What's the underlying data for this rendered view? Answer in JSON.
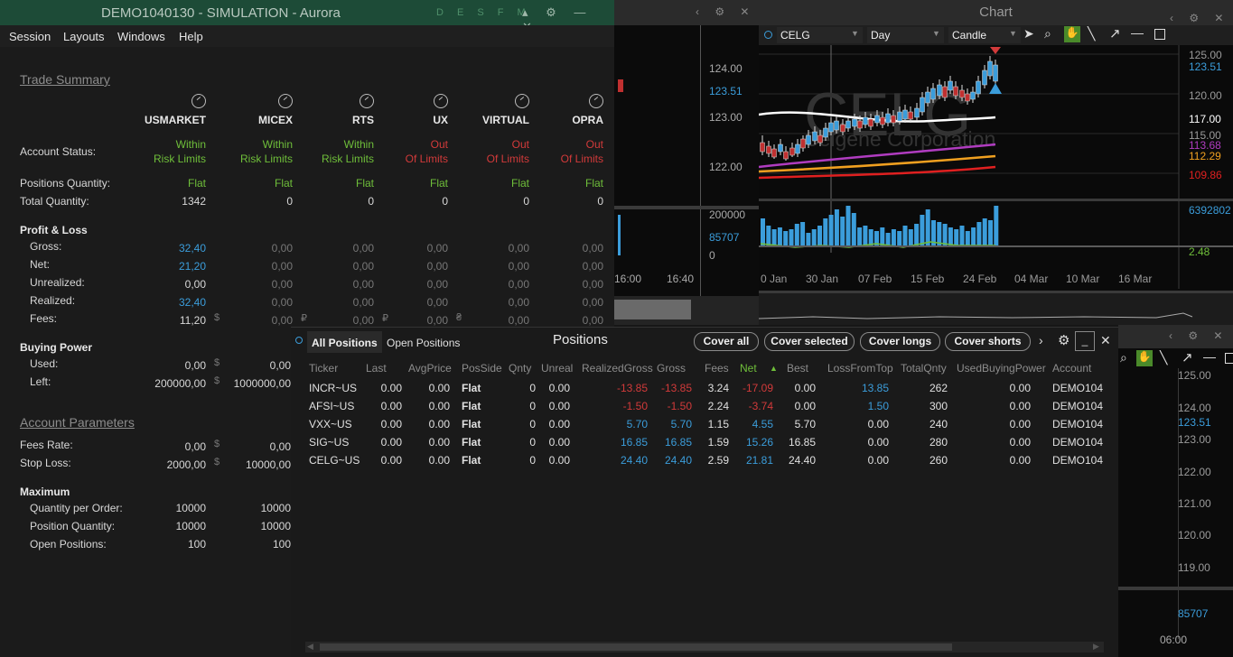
{
  "main_window": {
    "title": "DEMO1040130 - SIMULATION - Aurora",
    "title_icons": "D E S F M",
    "menu": [
      "Session",
      "Layouts",
      "Windows",
      "Help"
    ]
  },
  "trade_summary": {
    "title": "Trade Summary",
    "columns": [
      "USMARKET",
      "MICEX",
      "RTS",
      "UX",
      "VIRTUAL",
      "OPRA"
    ],
    "account_status_label": "Account Status:",
    "account_status": [
      {
        "l1": "Within",
        "l2": "Risk Limits",
        "color": "#6fbf3a"
      },
      {
        "l1": "Within",
        "l2": "Risk Limits",
        "color": "#6fbf3a"
      },
      {
        "l1": "Within",
        "l2": "Risk Limits",
        "color": "#6fbf3a"
      },
      {
        "l1": "Out",
        "l2": "Of Limits",
        "color": "#d23a3a"
      },
      {
        "l1": "Out",
        "l2": "Of Limits",
        "color": "#d23a3a"
      },
      {
        "l1": "Out",
        "l2": "Of Limits",
        "color": "#d23a3a"
      }
    ],
    "positions_quantity_label": "Positions Quantity:",
    "positions_quantity": [
      "Flat",
      "Flat",
      "Flat",
      "Flat",
      "Flat",
      "Flat"
    ],
    "total_quantity_label": "Total Quantity:",
    "total_quantity": [
      "1342",
      "0",
      "0",
      "0",
      "0",
      "0"
    ],
    "pnl_label": "Profit & Loss",
    "gross_label": "Gross:",
    "gross": [
      "32,40",
      "0,00",
      "0,00",
      "0,00",
      "0,00",
      "0,00"
    ],
    "net_label": "Net:",
    "net": [
      "21,20",
      "0,00",
      "0,00",
      "0,00",
      "0,00",
      "0,00"
    ],
    "unrealized_label": "Unrealized:",
    "unrealized": [
      "0,00",
      "0,00",
      "0,00",
      "0,00",
      "0,00",
      "0,00"
    ],
    "realized_label": "Realized:",
    "realized": [
      "32,40",
      "0,00",
      "0,00",
      "0,00",
      "0,00",
      "0,00"
    ],
    "fees_label": "Fees:",
    "fees": [
      "11,20",
      "0,00",
      "0,00",
      "0,00",
      "0,00",
      "0,00"
    ],
    "fees_currency": [
      "$",
      "₽",
      "₽",
      "₴",
      ""
    ],
    "buying_power_label": "Buying Power",
    "used_label": "Used:",
    "used": [
      "0,00",
      "0,00"
    ],
    "left_label": "Left:",
    "left": [
      "200000,00",
      "1000000,00"
    ],
    "currency_usd": "$"
  },
  "account_parameters": {
    "title": "Account Parameters",
    "fees_rate_label": "Fees Rate:",
    "fees_rate": [
      "0,00",
      "0,00"
    ],
    "stop_loss_label": "Stop Loss:",
    "stop_loss": [
      "2000,00",
      "10000,00"
    ],
    "maximum_label": "Maximum",
    "qpo_label": "Quantity per Order:",
    "qpo": [
      "10000",
      "10000"
    ],
    "pq_label": "Position Quantity:",
    "pq": [
      "10000",
      "10000"
    ],
    "op_label": "Open Positions:",
    "op": [
      "100",
      "100"
    ]
  },
  "positions": {
    "tab_all": "All Positions",
    "tab_open": "Open Positions",
    "title": "Positions",
    "buttons": [
      "Cover all",
      "Cover selected",
      "Cover longs",
      "Cover shorts"
    ],
    "headers": [
      "Ticker",
      "Last",
      "AvgPrice",
      "PosSide",
      "Qnty",
      "Unreal",
      "RealizedGross",
      "Gross",
      "Fees",
      "Net",
      "Best",
      "LossFromTop",
      "TotalQnty",
      "UsedBuyingPower",
      "Account"
    ],
    "rows": [
      [
        "INCR~US",
        "0.00",
        "0.00",
        "Flat",
        "0",
        "0.00",
        "-13.85",
        "-13.85",
        "3.24",
        "-17.09",
        "0.00",
        "13.85",
        "262",
        "0.00",
        "DEMO104"
      ],
      [
        "AFSI~US",
        "0.00",
        "0.00",
        "Flat",
        "0",
        "0.00",
        "-1.50",
        "-1.50",
        "2.24",
        "-3.74",
        "0.00",
        "1.50",
        "300",
        "0.00",
        "DEMO104"
      ],
      [
        "VXX~US",
        "0.00",
        "0.00",
        "Flat",
        "0",
        "0.00",
        "5.70",
        "5.70",
        "1.15",
        "4.55",
        "5.70",
        "0.00",
        "240",
        "0.00",
        "DEMO104"
      ],
      [
        "SIG~US",
        "0.00",
        "0.00",
        "Flat",
        "0",
        "0.00",
        "16.85",
        "16.85",
        "1.59",
        "15.26",
        "16.85",
        "0.00",
        "280",
        "0.00",
        "DEMO104"
      ],
      [
        "CELG~US",
        "0.00",
        "0.00",
        "Flat",
        "0",
        "0.00",
        "24.40",
        "24.40",
        "2.59",
        "21.81",
        "24.40",
        "0.00",
        "260",
        "0.00",
        "DEMO104"
      ]
    ]
  },
  "chart": {
    "title": "Chart",
    "symbol": "CELG",
    "interval": "Day",
    "style": "Candle",
    "watermark_symbol": "CELG",
    "watermark_name": "Celgene Corporation",
    "price_labels": [
      {
        "v": "125.00",
        "color": "#9a9a9a"
      },
      {
        "v": "123.51",
        "color": "#3b9ddb"
      },
      {
        "v": "120.00",
        "color": "#9a9a9a"
      },
      {
        "v": "117.00",
        "color": "#ffffff"
      },
      {
        "v": "115.00",
        "color": "#9a9a9a"
      },
      {
        "v": "113.68",
        "color": "#b03cc0"
      },
      {
        "v": "112.29",
        "color": "#f0a020"
      },
      {
        "v": "109.86",
        "color": "#e02020"
      },
      {
        "v": "110.00",
        "color": "#9a9a9a"
      }
    ],
    "volume_label": "6392802",
    "osc_label": "2.48",
    "dates": [
      "0 Jan",
      "30 Jan",
      "07 Feb",
      "15 Feb",
      "24 Feb",
      "04 Mar",
      "10 Mar",
      "16 Mar"
    ]
  },
  "mid_chart": {
    "prices": [
      "124.00",
      "123.51",
      "123.00",
      "122.00"
    ],
    "volume": [
      "200000",
      "85707",
      "0"
    ],
    "times": [
      "16:00",
      "16:40"
    ]
  },
  "right_chart": {
    "prices": [
      "125.00",
      "124.00",
      "123.51",
      "123.00",
      "122.00",
      "121.00",
      "120.00",
      "119.00",
      "85707"
    ],
    "time": "06:00"
  }
}
